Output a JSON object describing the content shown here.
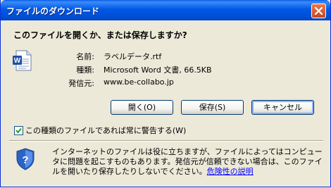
{
  "window": {
    "title": "ファイルのダウンロード"
  },
  "prompt": {
    "question": "このファイルを開くか、または保存しますか?"
  },
  "file": {
    "name_label": "名前:",
    "name_value": "ラベルデータ.rtf",
    "type_label": "種類:",
    "type_value": "Microsoft Word 文書, 66.5KB",
    "source_label": "発信元:",
    "source_value": "www.be-collabo.jp"
  },
  "buttons": {
    "open": "開く(O)",
    "save": "保存(S)",
    "cancel": "キャンセル"
  },
  "checkbox": {
    "label": "この種類のファイルであれば常に警告する(W)",
    "checked": true
  },
  "warning": {
    "text": "インターネットのファイルは役に立ちますが、ファイルによってはコンピュータに問題を起こすものもあります。発信元が信頼できない場合は、このファイルを開いたり保存したりしないでください。",
    "link": "危険性の説明"
  }
}
